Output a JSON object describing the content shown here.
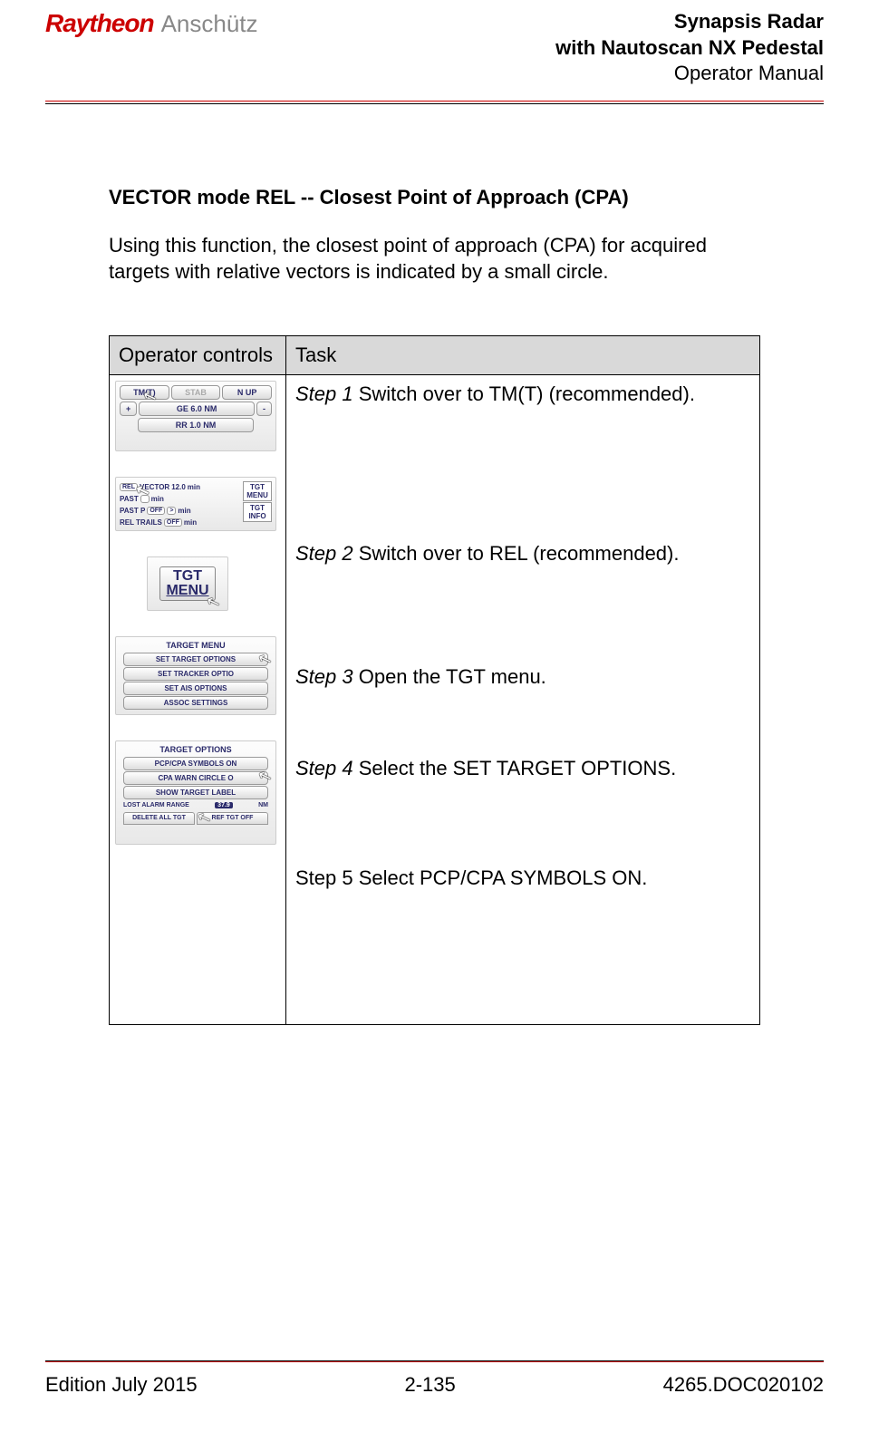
{
  "header": {
    "logo1": "Raytheon",
    "logo2": "Anschütz",
    "line1": "Synapsis Radar",
    "line2": "with Nautoscan NX Pedestal",
    "line3": "Operator Manual"
  },
  "section": {
    "title": "VECTOR mode REL -- Closest Point of Approach (CPA)",
    "desc": "Using this function, the closest point of approach (CPA) for acquired targets with relative vectors is indicated by a small circle."
  },
  "table": {
    "col1": "Operator controls",
    "col2": "Task",
    "steps": {
      "s1_label": "Step 1",
      "s1_text": " Switch over to TM(T) (recommended).",
      "s2_label": "Step 2",
      "s2_text": " Switch over to REL (recommended).",
      "s3_label": "Step 3",
      "s3_text": " Open the TGT menu.",
      "s4_label": "Step 4",
      "s4_text": " Select the SET TARGET OPTIONS.",
      "s5": "Step 5 Select PCP/CPA SYMBOLS ON."
    }
  },
  "ui1": {
    "tm": "TM(T)",
    "stab": "STAB",
    "nup": "N UP",
    "plus": "+",
    "range": "GE 6.0 NM",
    "minus": "-",
    "rr": "RR 1.0 NM"
  },
  "ui2": {
    "r1a": "REL",
    "r1b": "VECTOR",
    "r1c": "12.0",
    "r1d": "min",
    "r2a": "PAST",
    "r2b": "",
    "r2c": "min",
    "r3a": "PAST P",
    "r3b": "OFF",
    "r3c": ">",
    "r3d": "min",
    "r4a": "REL",
    "r4b": "TRAILS",
    "r4c": "OFF",
    "r4d": "min",
    "side1": "TGT",
    "side2": "MENU",
    "side3": "TGT",
    "side4": "INFO"
  },
  "ui3": {
    "l1": "TGT",
    "l2": "MENU"
  },
  "ui4": {
    "title": "TARGET MENU",
    "b1": "SET TARGET OPTIONS",
    "b2": "SET TRACKER OPTIO",
    "b3": "SET AIS OPTIONS",
    "b4": "ASSOC SETTINGS"
  },
  "ui5": {
    "title": "TARGET OPTIONS",
    "b1": "PCP/CPA SYMBOLS ON",
    "b2": "CPA WARN CIRCLE O",
    "b3": "SHOW TARGET LABEL",
    "range_label": "LOST ALARM RANGE",
    "range_val": "37.9",
    "range_unit": "NM",
    "bot1": "DELETE\nALL TGT",
    "bot2": "REF TGT\nOFF"
  },
  "footer": {
    "left": "Edition July 2015",
    "center": "2-135",
    "right": "4265.DOC020102"
  }
}
